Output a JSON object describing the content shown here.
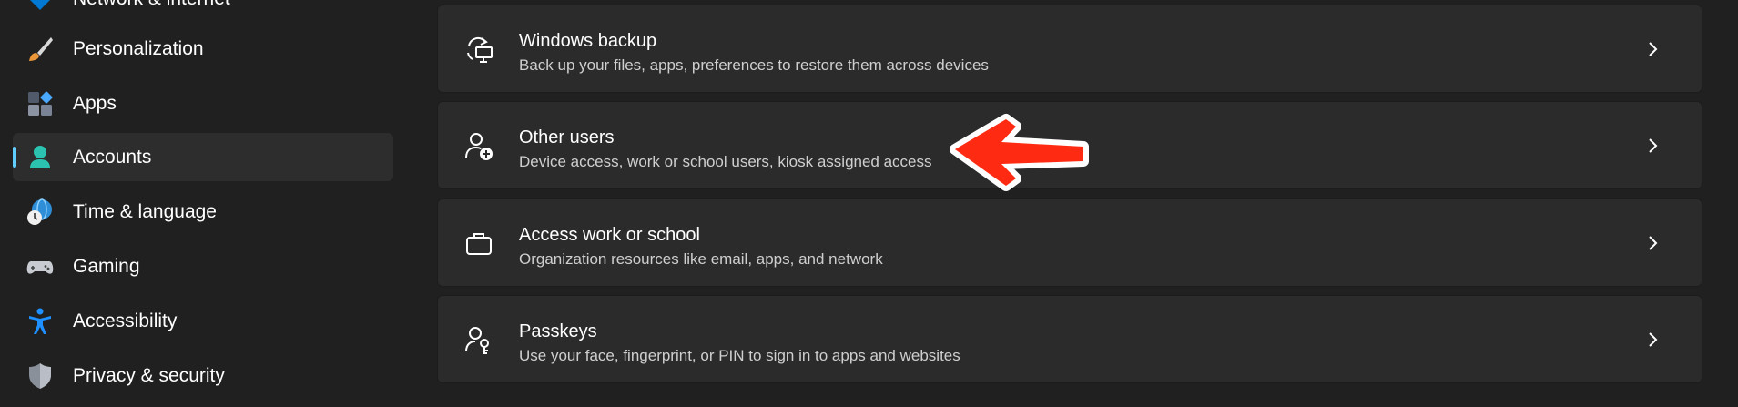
{
  "sidebar": {
    "items": [
      {
        "label": "Network & internet",
        "icon": "network-icon"
      },
      {
        "label": "Personalization",
        "icon": "brush-icon"
      },
      {
        "label": "Apps",
        "icon": "apps-icon"
      },
      {
        "label": "Accounts",
        "icon": "accounts-icon",
        "selected": true
      },
      {
        "label": "Time & language",
        "icon": "globe-clock-icon"
      },
      {
        "label": "Gaming",
        "icon": "gamepad-icon"
      },
      {
        "label": "Accessibility",
        "icon": "accessibility-icon"
      },
      {
        "label": "Privacy & security",
        "icon": "shield-icon"
      }
    ]
  },
  "main": {
    "cards": [
      {
        "title": "Windows backup",
        "description": "Back up your files, apps, preferences to restore them across devices",
        "icon": "backup-icon"
      },
      {
        "title": "Other users",
        "description": "Device access, work or school users, kiosk assigned access",
        "icon": "add-user-icon"
      },
      {
        "title": "Access work or school",
        "description": "Organization resources like email, apps, and network",
        "icon": "briefcase-icon"
      },
      {
        "title": "Passkeys",
        "description": "Use your face, fingerprint, or PIN to sign in to apps and websites",
        "icon": "passkey-icon"
      }
    ]
  },
  "annotation": {
    "color": "#ff2a12",
    "icon": "red-arrow-pointer"
  },
  "colors": {
    "background": "#202020",
    "card": "#2b2b2b",
    "selected": "#2d2d2d",
    "accent": "#60cdff"
  }
}
